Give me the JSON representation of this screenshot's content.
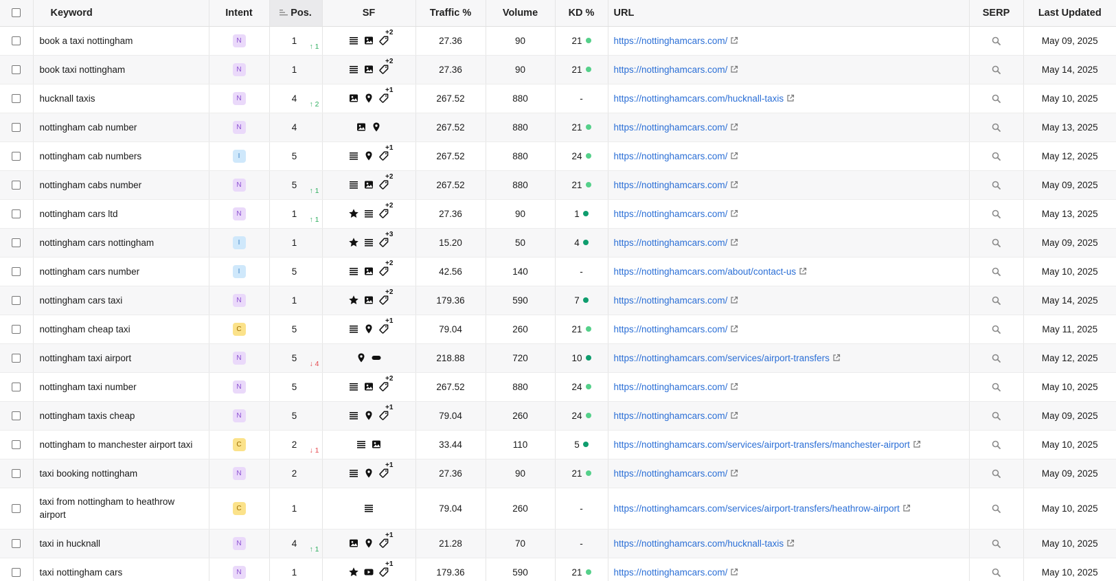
{
  "columns": {
    "keyword": "Keyword",
    "intent": "Intent",
    "pos": "Pos.",
    "sf": "SF",
    "traffic": "Traffic %",
    "volume": "Volume",
    "kd": "KD %",
    "url": "URL",
    "serp": "SERP",
    "updated": "Last Updated"
  },
  "colors": {
    "link": "#2b6fd6",
    "up": "#2fae5f",
    "down": "#e5484d",
    "kd_light": "#55d08a",
    "kd_dark": "#0f9d6e",
    "intent_N": "#ead9fa",
    "intent_I": "#cfe8fb",
    "intent_C": "#fbe28a"
  },
  "rows": [
    {
      "keyword": "book a taxi nottingham",
      "intent": "N",
      "pos": "1",
      "delta": "↑ 1",
      "delta_dir": "up",
      "sf": [
        "list",
        "image",
        "tag"
      ],
      "sf_more": "+2",
      "traffic": "27.36",
      "volume": "90",
      "kd": "21",
      "kd_level": "light",
      "url": "https://nottinghamcars.com/",
      "updated": "May 09, 2025"
    },
    {
      "keyword": "book taxi nottingham",
      "intent": "N",
      "pos": "1",
      "delta": "",
      "delta_dir": "",
      "sf": [
        "list",
        "image",
        "tag"
      ],
      "sf_more": "+2",
      "traffic": "27.36",
      "volume": "90",
      "kd": "21",
      "kd_level": "light",
      "url": "https://nottinghamcars.com/",
      "updated": "May 14, 2025"
    },
    {
      "keyword": "hucknall taxis",
      "intent": "N",
      "pos": "4",
      "delta": "↑ 2",
      "delta_dir": "up",
      "sf": [
        "image",
        "pin",
        "tag"
      ],
      "sf_more": "+1",
      "traffic": "267.52",
      "volume": "880",
      "kd": "-",
      "kd_level": "",
      "url": "https://nottinghamcars.com/hucknall-taxis",
      "updated": "May 10, 2025"
    },
    {
      "keyword": "nottingham cab number",
      "intent": "N",
      "pos": "4",
      "delta": "",
      "delta_dir": "",
      "sf": [
        "image",
        "pin"
      ],
      "sf_more": "",
      "traffic": "267.52",
      "volume": "880",
      "kd": "21",
      "kd_level": "light",
      "url": "https://nottinghamcars.com/",
      "updated": "May 13, 2025"
    },
    {
      "keyword": "nottingham cab numbers",
      "intent": "I",
      "pos": "5",
      "delta": "",
      "delta_dir": "",
      "sf": [
        "list",
        "pin",
        "tag"
      ],
      "sf_more": "+1",
      "traffic": "267.52",
      "volume": "880",
      "kd": "24",
      "kd_level": "light",
      "url": "https://nottinghamcars.com/",
      "updated": "May 12, 2025"
    },
    {
      "keyword": "nottingham cabs number",
      "intent": "N",
      "pos": "5",
      "delta": "↑ 1",
      "delta_dir": "up",
      "sf": [
        "list",
        "image",
        "tag"
      ],
      "sf_more": "+2",
      "traffic": "267.52",
      "volume": "880",
      "kd": "21",
      "kd_level": "light",
      "url": "https://nottinghamcars.com/",
      "updated": "May 09, 2025"
    },
    {
      "keyword": "nottingham cars ltd",
      "intent": "N",
      "pos": "1",
      "delta": "↑ 1",
      "delta_dir": "up",
      "sf": [
        "star",
        "list",
        "tag"
      ],
      "sf_more": "+2",
      "traffic": "27.36",
      "volume": "90",
      "kd": "1",
      "kd_level": "dark",
      "url": "https://nottinghamcars.com/",
      "updated": "May 13, 2025"
    },
    {
      "keyword": "nottingham cars nottingham",
      "intent": "I",
      "pos": "1",
      "delta": "",
      "delta_dir": "",
      "sf": [
        "star",
        "list",
        "tag"
      ],
      "sf_more": "+3",
      "traffic": "15.20",
      "volume": "50",
      "kd": "4",
      "kd_level": "dark",
      "url": "https://nottinghamcars.com/",
      "updated": "May 09, 2025"
    },
    {
      "keyword": "nottingham cars number",
      "intent": "I",
      "pos": "5",
      "delta": "",
      "delta_dir": "",
      "sf": [
        "list",
        "image",
        "tag"
      ],
      "sf_more": "+2",
      "traffic": "42.56",
      "volume": "140",
      "kd": "-",
      "kd_level": "",
      "url": "https://nottinghamcars.com/about/contact-us",
      "updated": "May 10, 2025"
    },
    {
      "keyword": "nottingham cars taxi",
      "intent": "N",
      "pos": "1",
      "delta": "",
      "delta_dir": "",
      "sf": [
        "star",
        "image",
        "tag"
      ],
      "sf_more": "+2",
      "traffic": "179.36",
      "volume": "590",
      "kd": "7",
      "kd_level": "dark",
      "url": "https://nottinghamcars.com/",
      "updated": "May 14, 2025"
    },
    {
      "keyword": "nottingham cheap taxi",
      "intent": "C",
      "pos": "5",
      "delta": "",
      "delta_dir": "",
      "sf": [
        "list",
        "pin",
        "tag"
      ],
      "sf_more": "+1",
      "traffic": "79.04",
      "volume": "260",
      "kd": "21",
      "kd_level": "light",
      "url": "https://nottinghamcars.com/",
      "updated": "May 11, 2025"
    },
    {
      "keyword": "nottingham taxi airport",
      "intent": "N",
      "pos": "5",
      "delta": "↓ 4",
      "delta_dir": "down",
      "sf": [
        "pin",
        "pill"
      ],
      "sf_more": "",
      "traffic": "218.88",
      "volume": "720",
      "kd": "10",
      "kd_level": "dark",
      "url": "https://nottinghamcars.com/services/airport-transfers",
      "updated": "May 12, 2025"
    },
    {
      "keyword": "nottingham taxi number",
      "intent": "N",
      "pos": "5",
      "delta": "",
      "delta_dir": "",
      "sf": [
        "list",
        "image",
        "tag"
      ],
      "sf_more": "+2",
      "traffic": "267.52",
      "volume": "880",
      "kd": "24",
      "kd_level": "light",
      "url": "https://nottinghamcars.com/",
      "updated": "May 10, 2025"
    },
    {
      "keyword": "nottingham taxis cheap",
      "intent": "N",
      "pos": "5",
      "delta": "",
      "delta_dir": "",
      "sf": [
        "list",
        "pin",
        "tag"
      ],
      "sf_more": "+1",
      "traffic": "79.04",
      "volume": "260",
      "kd": "24",
      "kd_level": "light",
      "url": "https://nottinghamcars.com/",
      "updated": "May 09, 2025"
    },
    {
      "keyword": "nottingham to manchester airport taxi",
      "intent": "C",
      "pos": "2",
      "delta": "↓ 1",
      "delta_dir": "down",
      "sf": [
        "list",
        "image"
      ],
      "sf_more": "",
      "traffic": "33.44",
      "volume": "110",
      "kd": "5",
      "kd_level": "dark",
      "url": "https://nottinghamcars.com/services/airport-transfers/manchester-airport",
      "updated": "May 10, 2025"
    },
    {
      "keyword": "taxi booking nottingham",
      "intent": "N",
      "pos": "2",
      "delta": "",
      "delta_dir": "",
      "sf": [
        "list",
        "pin",
        "tag"
      ],
      "sf_more": "+1",
      "traffic": "27.36",
      "volume": "90",
      "kd": "21",
      "kd_level": "light",
      "url": "https://nottinghamcars.com/",
      "updated": "May 09, 2025"
    },
    {
      "keyword": "taxi from nottingham to heathrow airport",
      "intent": "C",
      "pos": "1",
      "delta": "",
      "delta_dir": "",
      "sf": [
        "list"
      ],
      "sf_more": "",
      "traffic": "79.04",
      "volume": "260",
      "kd": "-",
      "kd_level": "",
      "url": "https://nottinghamcars.com/services/airport-transfers/heathrow-airport",
      "updated": "May 10, 2025",
      "tall": true
    },
    {
      "keyword": "taxi in hucknall",
      "intent": "N",
      "pos": "4",
      "delta": "↑ 1",
      "delta_dir": "up",
      "sf": [
        "image",
        "pin",
        "tag"
      ],
      "sf_more": "+1",
      "traffic": "21.28",
      "volume": "70",
      "kd": "-",
      "kd_level": "",
      "url": "https://nottinghamcars.com/hucknall-taxis",
      "updated": "May 10, 2025"
    },
    {
      "keyword": "taxi nottingham cars",
      "intent": "N",
      "pos": "1",
      "delta": "",
      "delta_dir": "",
      "sf": [
        "star",
        "video",
        "tag"
      ],
      "sf_more": "+1",
      "traffic": "179.36",
      "volume": "590",
      "kd": "21",
      "kd_level": "light",
      "url": "https://nottinghamcars.com/",
      "updated": "May 10, 2025"
    }
  ]
}
